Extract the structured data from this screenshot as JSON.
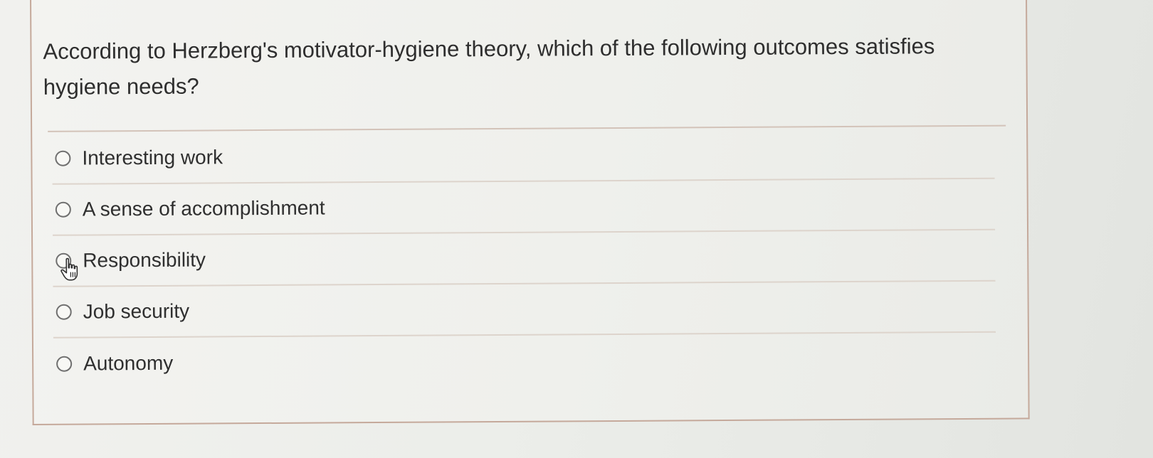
{
  "question": {
    "text": "According to Herzberg's motivator-hygiene theory, which of the following outcomes satisfies hygiene needs?"
  },
  "options": [
    {
      "label": "Interesting work"
    },
    {
      "label": "A sense of accomplishment"
    },
    {
      "label": "Responsibility"
    },
    {
      "label": "Job security"
    },
    {
      "label": "Autonomy"
    }
  ],
  "icons": {
    "radio": "radio-unselected-icon",
    "cursor": "hand-pointer-icon"
  },
  "colors": {
    "card_border": "#c5a99b",
    "text": "#2e2e2e",
    "radio_border": "#6f6f6f"
  }
}
